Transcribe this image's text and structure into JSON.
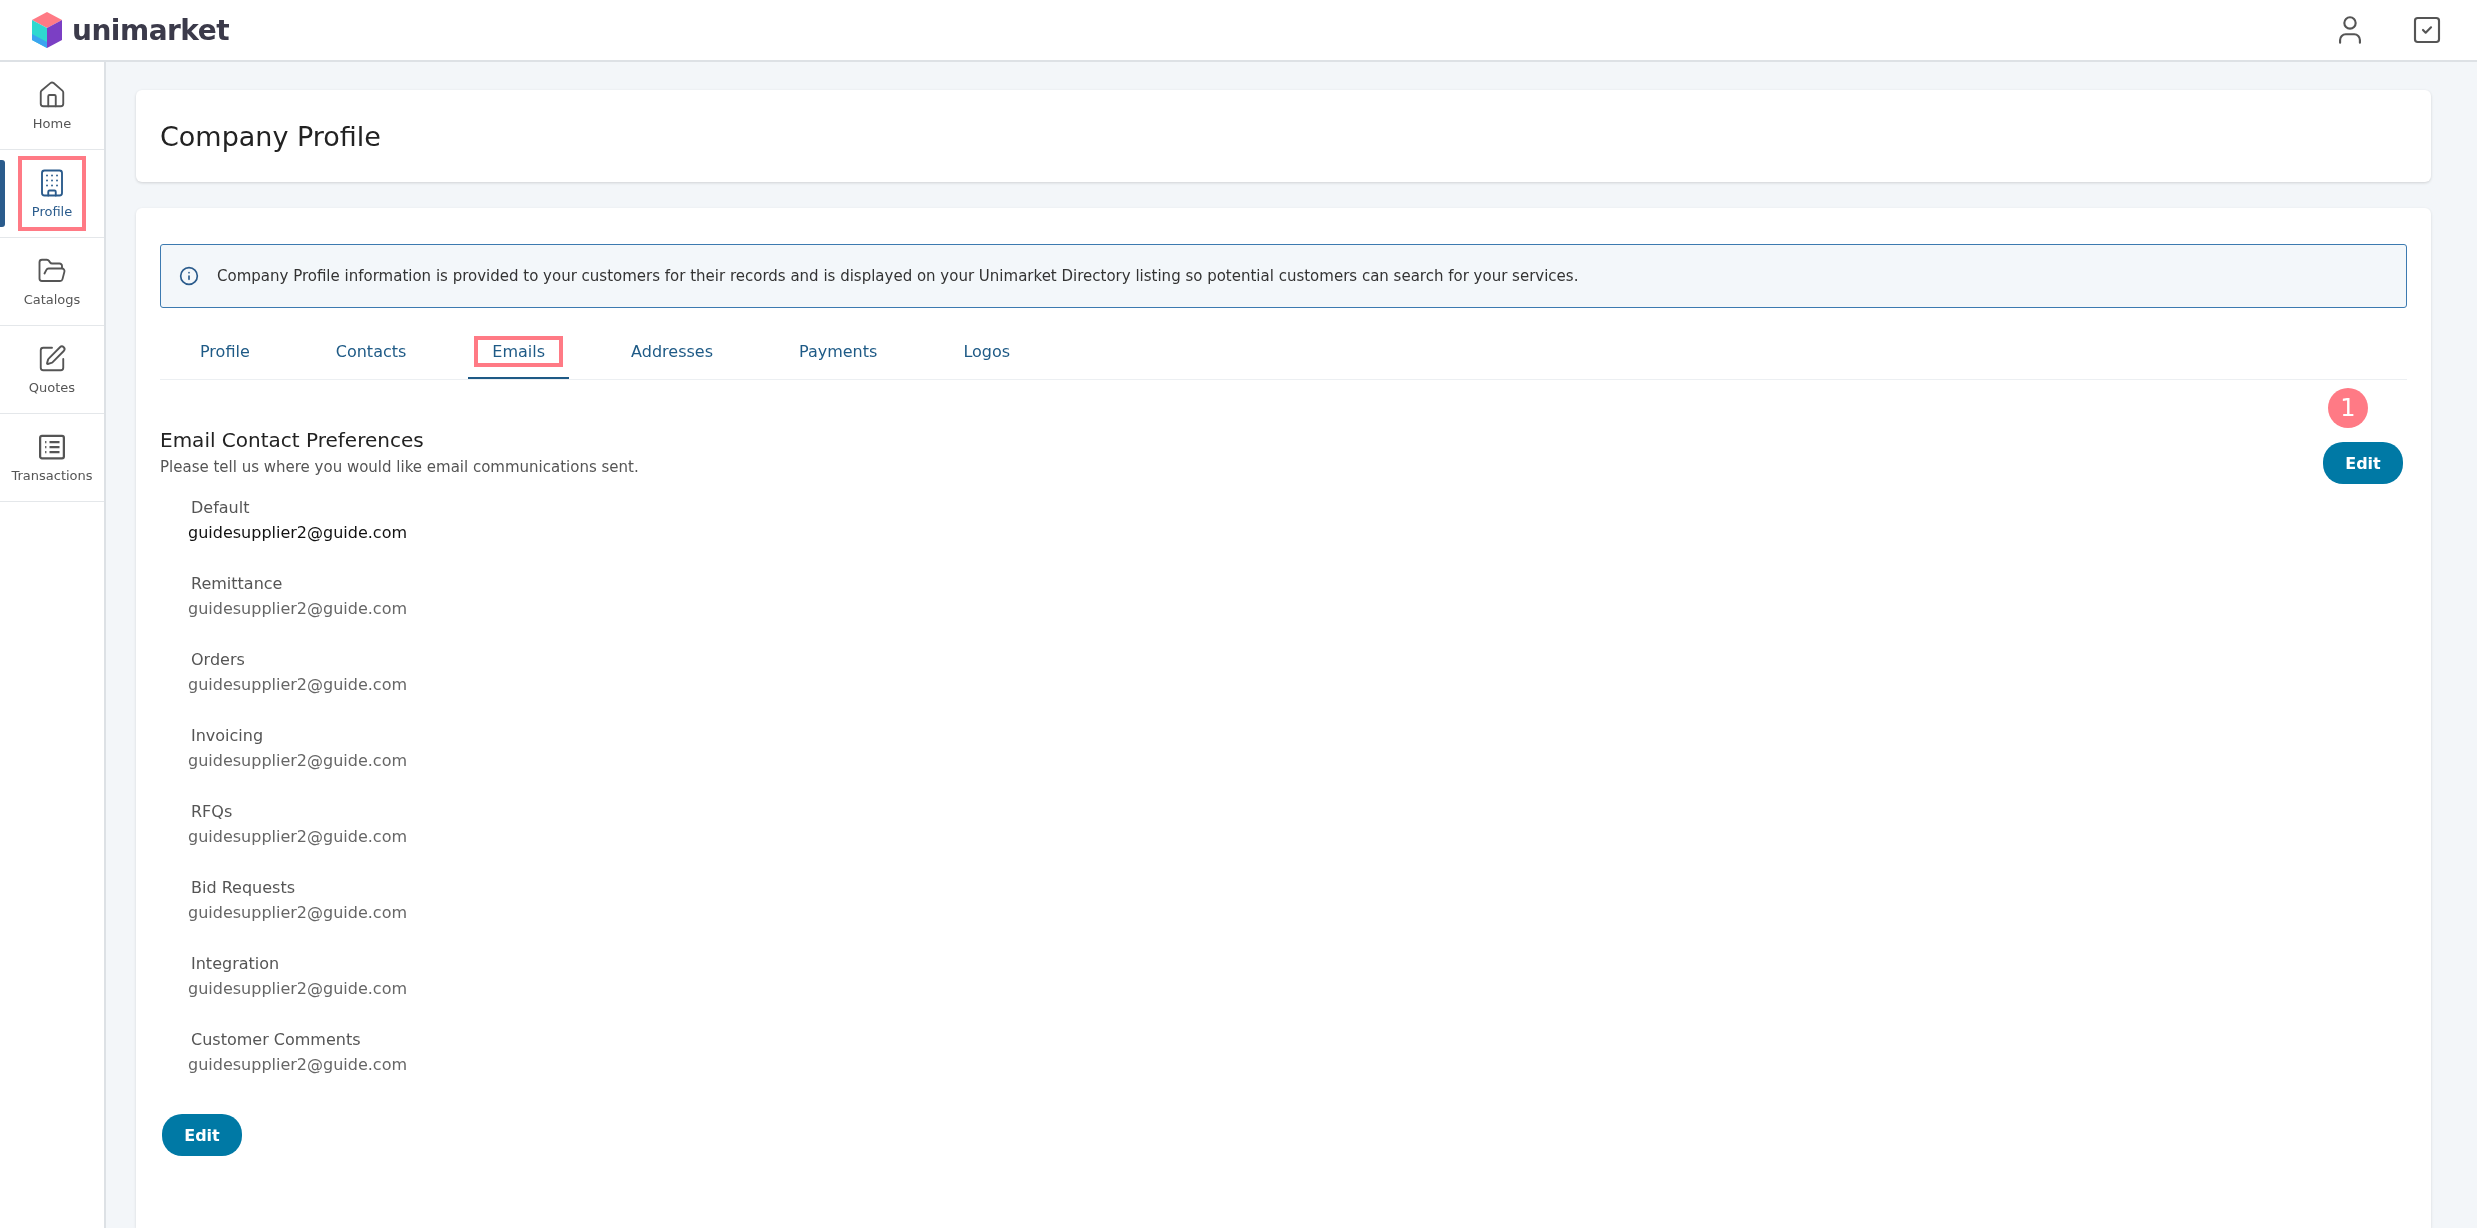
{
  "header": {
    "brand": "unimarket"
  },
  "sidebar": {
    "items": [
      {
        "label": "Home",
        "selected": false,
        "highlighted": false
      },
      {
        "label": "Profile",
        "selected": true,
        "highlighted": true
      },
      {
        "label": "Catalogs",
        "selected": false,
        "highlighted": false
      },
      {
        "label": "Quotes",
        "selected": false,
        "highlighted": false
      },
      {
        "label": "Transactions",
        "selected": false,
        "highlighted": false
      }
    ]
  },
  "page": {
    "title": "Company Profile"
  },
  "info": {
    "text": "Company Profile information is provided to your customers for their records and is displayed on your Unimarket Directory listing so potential customers can search for your services."
  },
  "tabs": [
    {
      "label": "Profile",
      "selected": false,
      "highlighted": false
    },
    {
      "label": "Contacts",
      "selected": false,
      "highlighted": false
    },
    {
      "label": "Emails",
      "selected": true,
      "highlighted": true
    },
    {
      "label": "Addresses",
      "selected": false,
      "highlighted": false
    },
    {
      "label": "Payments",
      "selected": false,
      "highlighted": false
    },
    {
      "label": "Logos",
      "selected": false,
      "highlighted": false
    }
  ],
  "section": {
    "title": "Email Contact Preferences",
    "subtitle": "Please tell us where you would like email communications sent.",
    "step_badge": "1",
    "edit_button": "Edit"
  },
  "emails": [
    {
      "label": "Default",
      "email": "guidesupplier2@guide.com",
      "primary": true
    },
    {
      "label": "Remittance",
      "email": "guidesupplier2@guide.com",
      "primary": false
    },
    {
      "label": "Orders",
      "email": "guidesupplier2@guide.com",
      "primary": false
    },
    {
      "label": "Invoicing",
      "email": "guidesupplier2@guide.com",
      "primary": false
    },
    {
      "label": "RFQs",
      "email": "guidesupplier2@guide.com",
      "primary": false
    },
    {
      "label": "Bid Requests",
      "email": "guidesupplier2@guide.com",
      "primary": false
    },
    {
      "label": "Integration",
      "email": "guidesupplier2@guide.com",
      "primary": false
    },
    {
      "label": "Customer Comments",
      "email": "guidesupplier2@guide.com",
      "primary": false
    }
  ],
  "bottom_button": "Edit"
}
